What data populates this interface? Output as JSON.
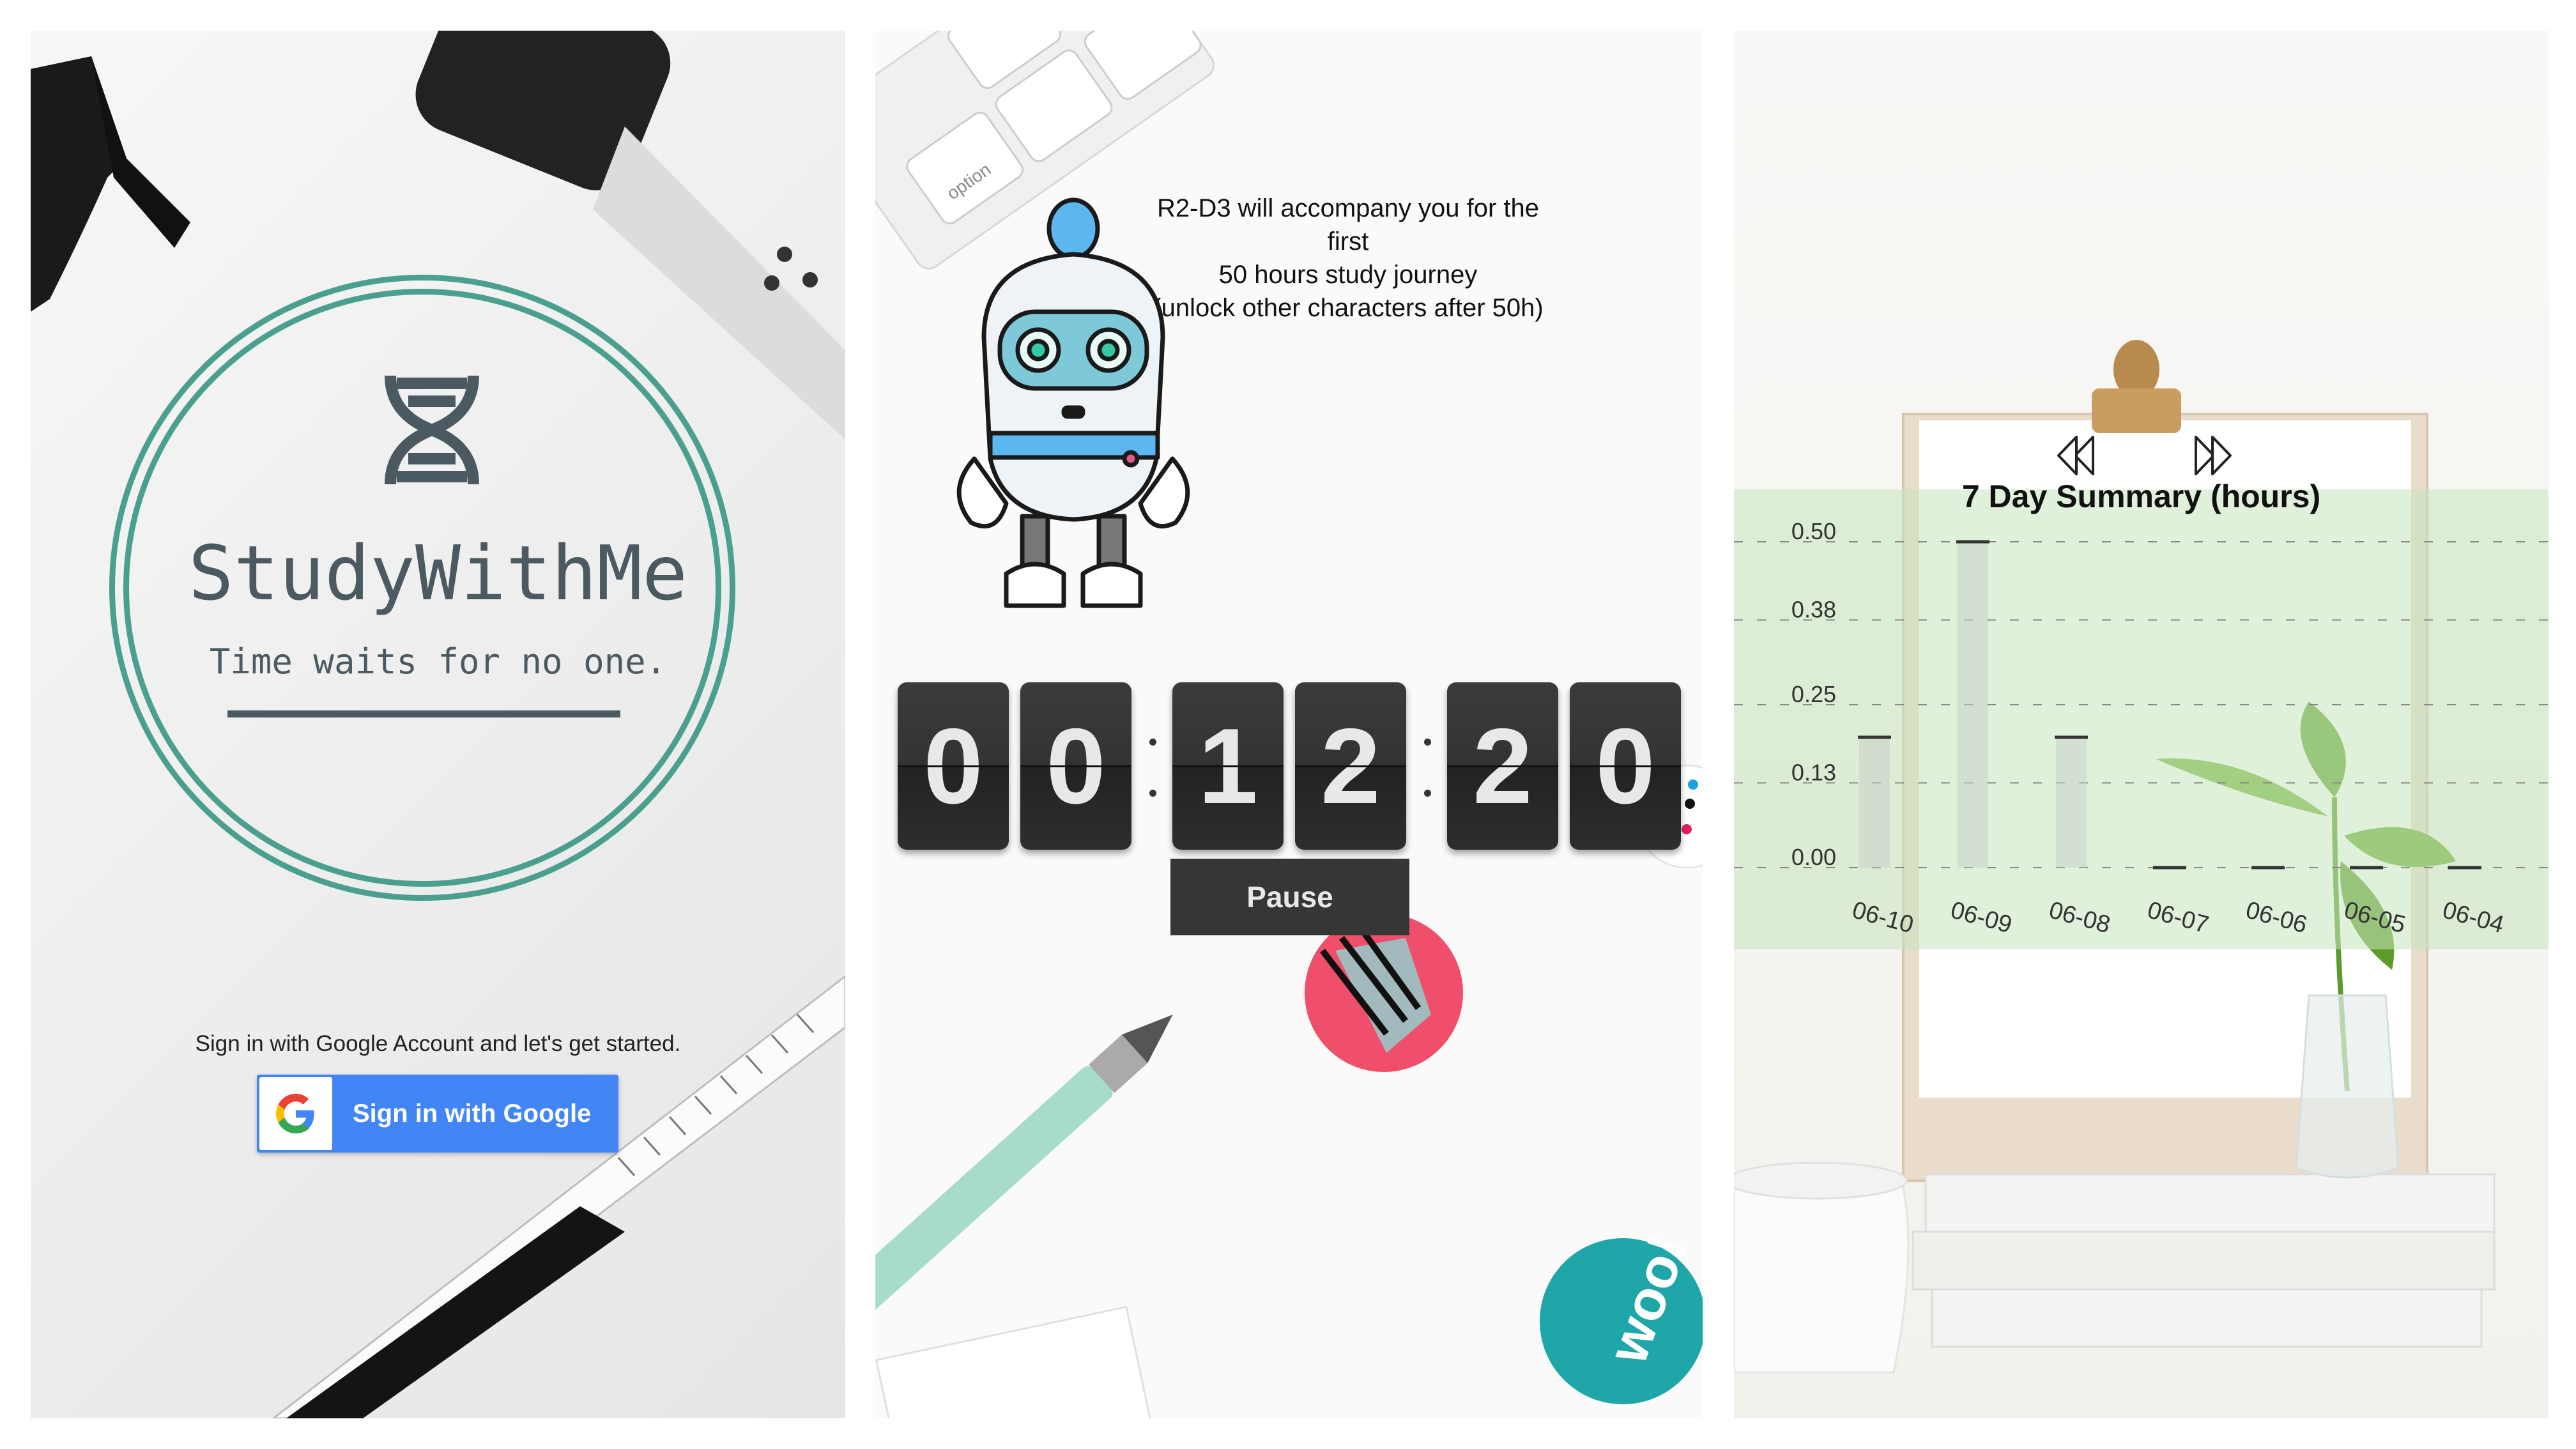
{
  "login": {
    "app_name": "StudyWithMe",
    "tagline": "Time waits for no one.",
    "signin_prompt": "Sign in with Google Account and let's get started.",
    "google_button_label": "Sign in with Google",
    "accent_color": "#4a9f8f",
    "google_blue": "#4285f4"
  },
  "timer": {
    "robot_message": [
      "R2-D3 will accompany you for the first",
      "50 hours study journey",
      "(unlock other characters after 50h)"
    ],
    "digits": [
      "0",
      "0",
      "1",
      "2",
      "2",
      "0"
    ],
    "pause_label": "Pause",
    "keyboard_key_label": "option"
  },
  "summary": {
    "prev_icon": "double-chevron-left-icon",
    "next_icon": "double-chevron-right-icon",
    "chart_data": {
      "type": "bar",
      "title": "7 Day Summary (hours)",
      "categories": [
        "06-10",
        "06-09",
        "06-08",
        "06-07",
        "06-06",
        "06-05",
        "06-04"
      ],
      "values": [
        0.2,
        0.5,
        0.2,
        0,
        0,
        0,
        0
      ],
      "y_ticks": [
        "0.50",
        "0.38",
        "0.25",
        "0.13",
        "0.00"
      ],
      "ylim": [
        0,
        0.5
      ],
      "grid": true
    }
  }
}
